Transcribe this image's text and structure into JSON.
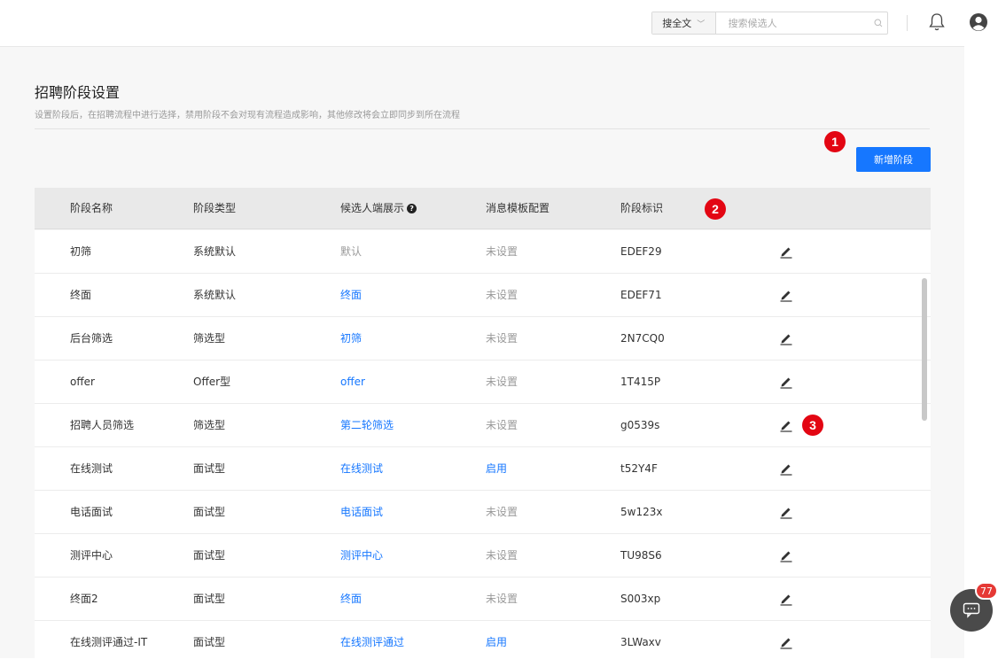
{
  "topbar": {
    "search_scope": "搜全文",
    "search_placeholder": "搜索候选人"
  },
  "page": {
    "title": "招聘阶段设置",
    "description": "设置阶段后，在招聘流程中进行选择，禁用阶段不会对现有流程造成影响，其他修改将会立即同步到所在流程",
    "add_button": "新增阶段"
  },
  "badges": {
    "one": "1",
    "two": "2",
    "three": "3"
  },
  "table": {
    "columns": {
      "name": "阶段名称",
      "type": "阶段类型",
      "display": "候选人端展示",
      "template": "消息模板配置",
      "code": "阶段标识"
    },
    "help_icon": "?",
    "rows": [
      {
        "name": "初筛",
        "type": "系统默认",
        "display": "默认",
        "display_link": false,
        "template": "未设置",
        "template_link": false,
        "code": "EDEF29"
      },
      {
        "name": "终面",
        "type": "系统默认",
        "display": "终面",
        "display_link": true,
        "template": "未设置",
        "template_link": false,
        "code": "EDEF71"
      },
      {
        "name": "后台筛选",
        "type": "筛选型",
        "display": "初筛",
        "display_link": true,
        "template": "未设置",
        "template_link": false,
        "code": "2N7CQ0"
      },
      {
        "name": "offer",
        "type": "Offer型",
        "display": "offer",
        "display_link": true,
        "template": "未设置",
        "template_link": false,
        "code": "1T415P"
      },
      {
        "name": "招聘人员筛选",
        "type": "筛选型",
        "display": "第二轮筛选",
        "display_link": true,
        "template": "未设置",
        "template_link": false,
        "code": "g0539s"
      },
      {
        "name": "在线测试",
        "type": "面试型",
        "display": "在线测试",
        "display_link": true,
        "template": "启用",
        "template_link": true,
        "code": "t52Y4F"
      },
      {
        "name": "电话面试",
        "type": "面试型",
        "display": "电话面试",
        "display_link": true,
        "template": "未设置",
        "template_link": false,
        "code": "5w123x"
      },
      {
        "name": "测评中心",
        "type": "面试型",
        "display": "测评中心",
        "display_link": true,
        "template": "未设置",
        "template_link": false,
        "code": "TU98S6"
      },
      {
        "name": "终面2",
        "type": "面试型",
        "display": "终面",
        "display_link": true,
        "template": "未设置",
        "template_link": false,
        "code": "S003xp"
      },
      {
        "name": "在线测评通过-IT",
        "type": "面试型",
        "display": "在线测评通过",
        "display_link": true,
        "template": "启用",
        "template_link": true,
        "code": "3LWaxv"
      }
    ]
  },
  "chat": {
    "unread_count": "77"
  },
  "colors": {
    "accent": "#1677ff",
    "badge_red": "#e30613"
  }
}
